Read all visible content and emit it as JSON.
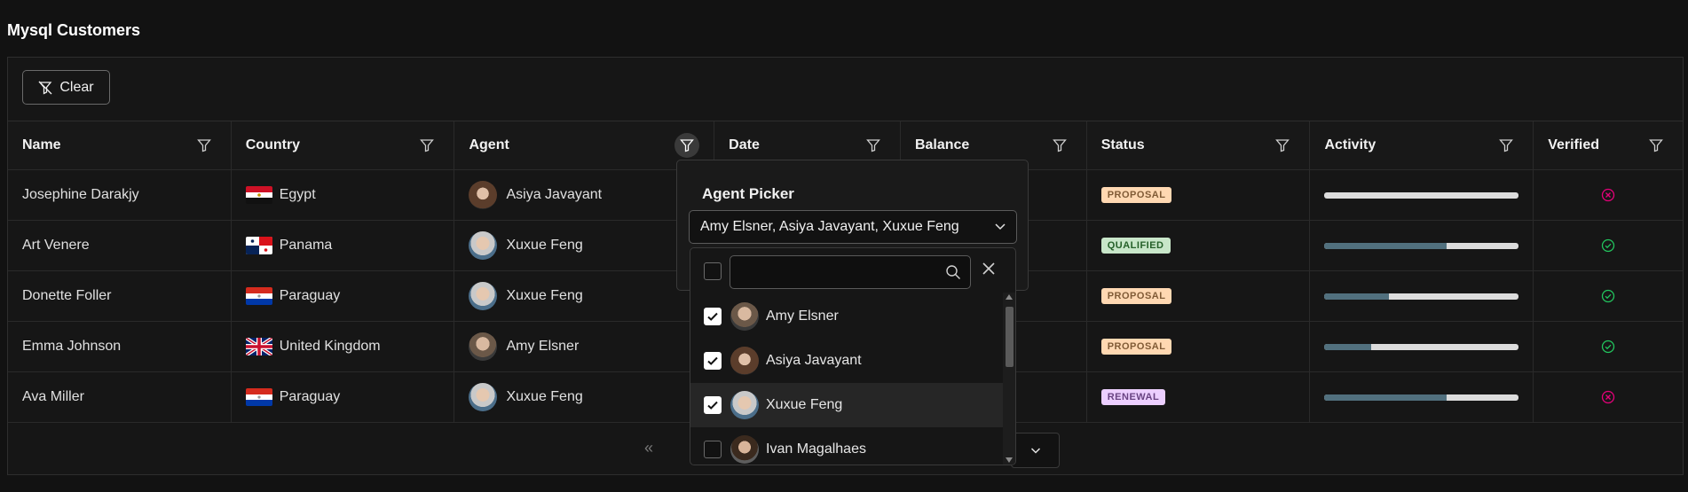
{
  "page": {
    "title": "Mysql Customers"
  },
  "toolbar": {
    "clear_label": "Clear",
    "clear_icon": "filter-slash-icon"
  },
  "columns": [
    "Name",
    "Country",
    "Agent",
    "Date",
    "Balance",
    "Status",
    "Activity",
    "Verified"
  ],
  "rows": [
    {
      "name": "Josephine Darakjy",
      "country": "Egypt",
      "agent": "Asiya Javayant",
      "status": "PROPOSAL",
      "activity": 0.0,
      "verified": false
    },
    {
      "name": "Art Venere",
      "country": "Panama",
      "agent": "Xuxue Feng",
      "status": "QUALIFIED",
      "activity": 0.63,
      "verified": true
    },
    {
      "name": "Donette Foller",
      "country": "Paraguay",
      "agent": "Xuxue Feng",
      "status": "PROPOSAL",
      "activity": 0.33,
      "verified": true
    },
    {
      "name": "Emma Johnson",
      "country": "United Kingdom",
      "agent": "Amy Elsner",
      "status": "PROPOSAL",
      "activity": 0.24,
      "verified": true
    },
    {
      "name": "Ava Miller",
      "country": "Paraguay",
      "agent": "Xuxue Feng",
      "status": "RENEWAL",
      "activity": 0.63,
      "verified": false
    }
  ],
  "agent_filter": {
    "title": "Agent Picker",
    "selected_text": "Amy Elsner, Asiya Javayant, Xuxue Feng",
    "search_placeholder": "",
    "options": [
      {
        "label": "Amy Elsner",
        "checked": true
      },
      {
        "label": "Asiya Javayant",
        "checked": true
      },
      {
        "label": "Xuxue Feng",
        "checked": true
      },
      {
        "label": "Ivan Magalhaes",
        "checked": false
      }
    ]
  },
  "paginator": {
    "first_icon": "double-chevron-left-icon",
    "rows_dropdown_icon": "chevron-down-icon"
  },
  "colors": {
    "background": "#121212",
    "activity_fill": "#51707e",
    "verified_true": "#22c55e",
    "verified_false": "#e6007a"
  }
}
